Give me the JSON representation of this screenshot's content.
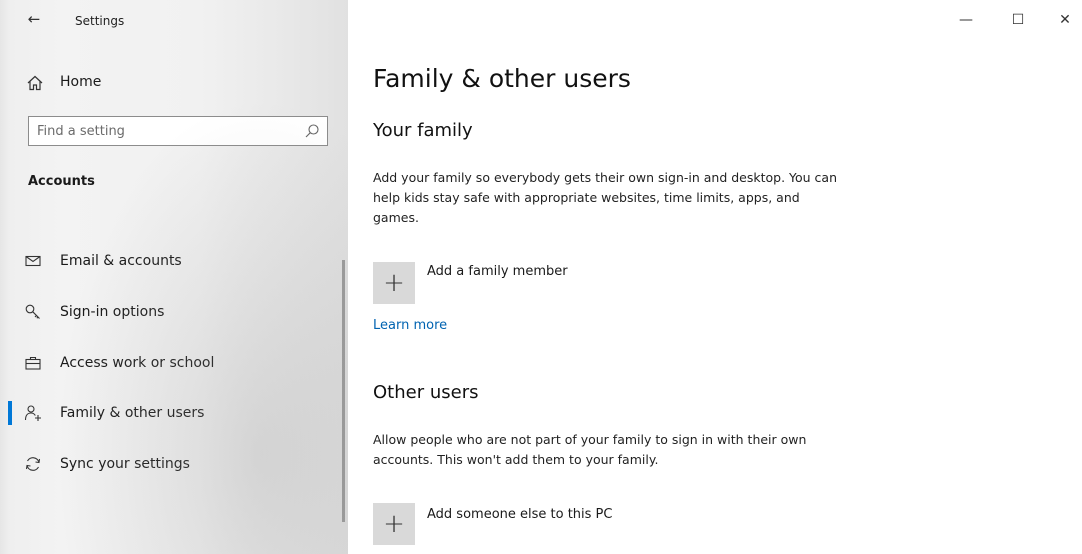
{
  "window": {
    "title": "Settings",
    "minimize_glyph": "—",
    "maximize_glyph": "☐",
    "close_glyph": "✕"
  },
  "sidebar": {
    "back_glyph": "←",
    "home_label": "Home",
    "search_placeholder": "Find a setting",
    "section_title": "Accounts",
    "items": [
      {
        "label": "Email & accounts",
        "icon": "mail-icon",
        "selected": false
      },
      {
        "label": "Sign-in options",
        "icon": "key-icon",
        "selected": false
      },
      {
        "label": "Access work or school",
        "icon": "briefcase-icon",
        "selected": false
      },
      {
        "label": "Family & other users",
        "icon": "person-add-icon",
        "selected": true
      },
      {
        "label": "Sync your settings",
        "icon": "sync-icon",
        "selected": false
      }
    ]
  },
  "main": {
    "title": "Family & other users",
    "family": {
      "heading": "Your family",
      "description": "Add your family so everybody gets their own sign-in and desktop. You can help kids stay safe with appropriate websites, time limits, apps, and games.",
      "add_label": "Add a family member",
      "learn_more": "Learn more"
    },
    "other": {
      "heading": "Other users",
      "description": "Allow people who are not part of your family to sign in with their own accounts. This won't add them to your family.",
      "add_label": "Add someone else to this PC"
    },
    "plus_glyph": "+"
  },
  "colors": {
    "accent": "#0078d7",
    "link": "#0063b1",
    "button_bg": "#d9d9d9"
  }
}
